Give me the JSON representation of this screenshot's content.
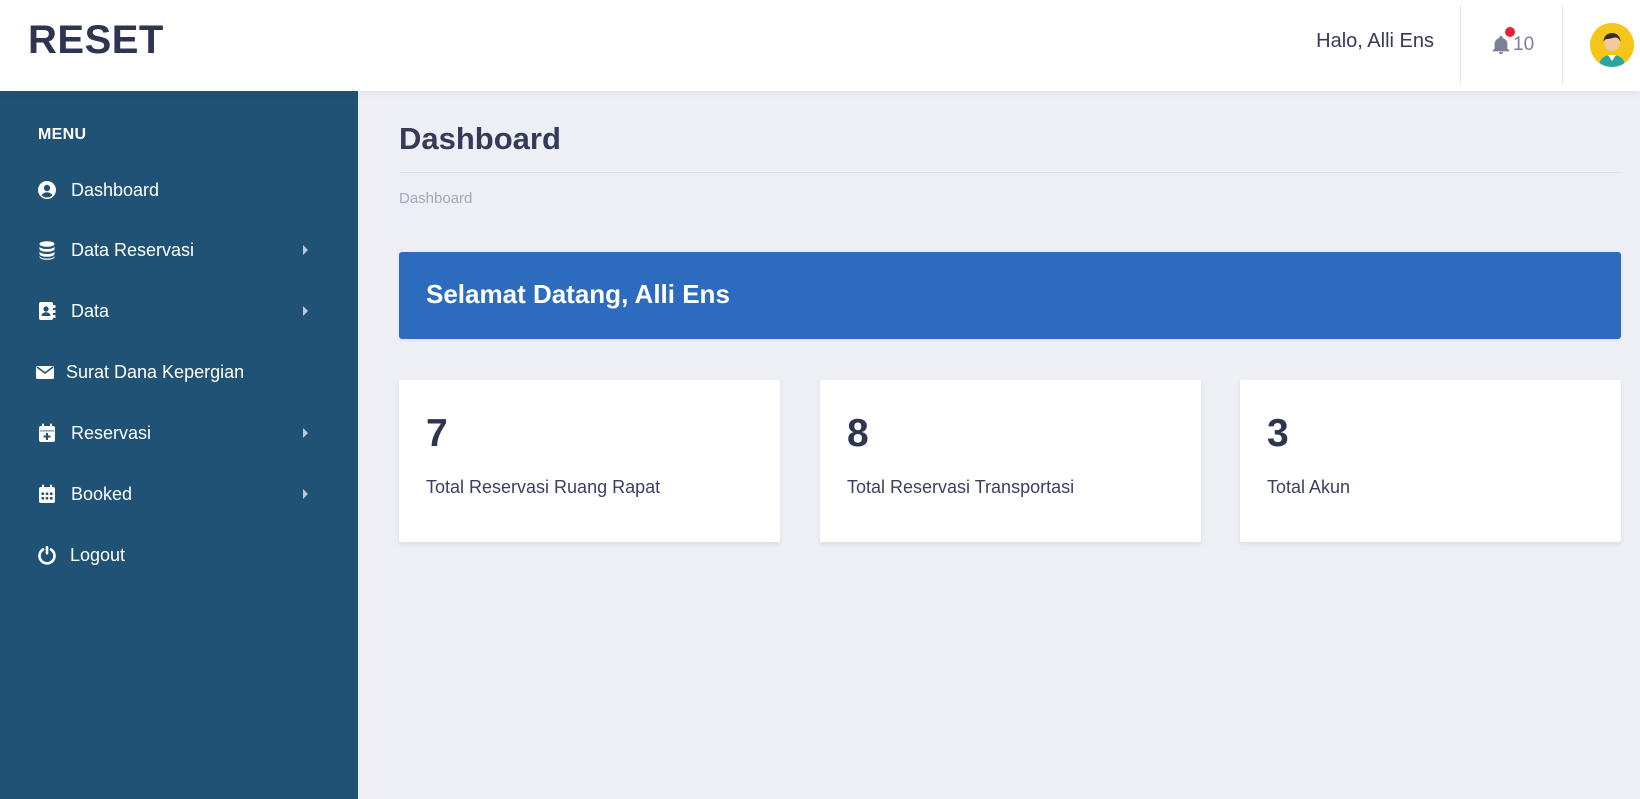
{
  "header": {
    "brand": "RESET",
    "greeting": "Halo, Alli Ens",
    "notification_count": "10",
    "notification_icon": "bell-icon",
    "avatar_icon": "user-avatar"
  },
  "sidebar": {
    "menu_title": "MENU",
    "items": [
      {
        "label": "Dashboard",
        "icon": "user-circle-icon",
        "has_submenu": false
      },
      {
        "label": "Data Reservasi",
        "icon": "database-icon",
        "has_submenu": true
      },
      {
        "label": "Data",
        "icon": "address-book-icon",
        "has_submenu": true
      },
      {
        "label": "Surat Dana Kepergian",
        "icon": "envelope-icon",
        "has_submenu": false
      },
      {
        "label": "Reservasi",
        "icon": "calendar-plus-icon",
        "has_submenu": true
      },
      {
        "label": "Booked",
        "icon": "calendar-icon",
        "has_submenu": true
      },
      {
        "label": "Logout",
        "icon": "power-icon",
        "has_submenu": false
      }
    ]
  },
  "main": {
    "title": "Dashboard",
    "breadcrumb": "Dashboard",
    "welcome": "Selamat Datang, Alli Ens",
    "cards": [
      {
        "value": "7",
        "label": "Total Reservasi Ruang Rapat"
      },
      {
        "value": "8",
        "label": "Total Reservasi Transportasi"
      },
      {
        "value": "3",
        "label": "Total Akun"
      }
    ]
  },
  "colors": {
    "sidebar_bg": "#1f5274",
    "welcome_bg": "#2d6bbf",
    "content_bg": "#eeeff5",
    "notification_dot": "#e8213a",
    "avatar_bg": "#f5c518"
  }
}
